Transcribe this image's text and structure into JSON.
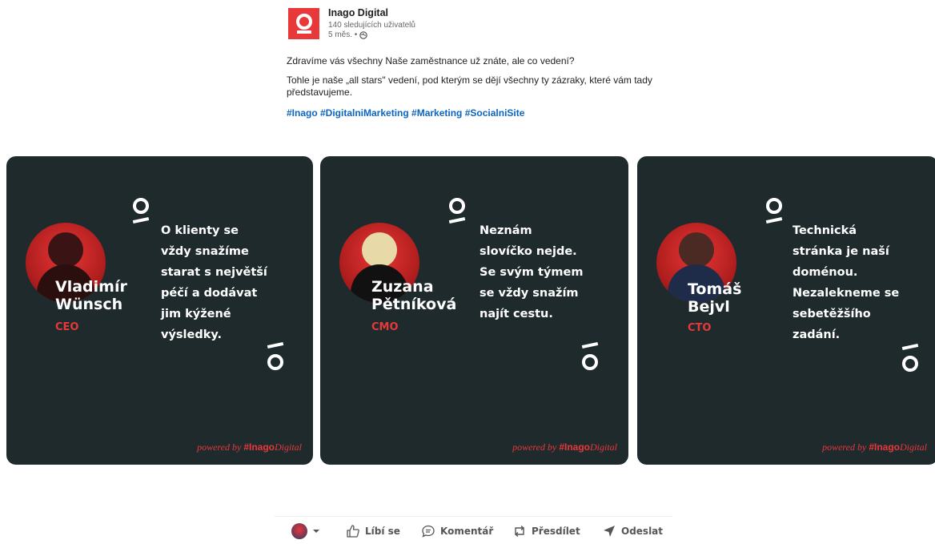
{
  "post": {
    "org_name": "Inago Digital",
    "followers": "140 sledujících uživatelů",
    "time": "5 měs. •",
    "line1": "Zdravíme vás všechny    Naše zaměstnance už znáte, ale co vedení?",
    "line2": "Tohle je naše „all stars\" vedení, pod kterým se dějí všechny ty zázraky, které vám tady představujeme.",
    "hashtags": "#Inago #DigitalniMarketing #Marketing #SocialniSite"
  },
  "cards": [
    {
      "name_line1": "Vladimír",
      "name_line2": "Wünsch",
      "role": "CEO",
      "quote": [
        "O klienty se",
        "vždy snažíme",
        "starat s největší",
        "péčí a dodávat",
        "jim kýžené",
        "výsledky."
      ]
    },
    {
      "name_line1": "Zuzana",
      "name_line2": "Pětníková",
      "role": "CMO",
      "quote": [
        "Neznám",
        "slovíčko nejde.",
        "Se svým týmem",
        "se vždy snažím",
        "najít cestu."
      ]
    },
    {
      "name_line1": "Tomáš",
      "name_line2": "Bejvl",
      "role": "CTO",
      "quote": [
        "Technická",
        "stránka je naší",
        "doménou.",
        "Nezalekneme se",
        "sebetěžšího",
        "zadání."
      ]
    }
  ],
  "powered": {
    "prefix": "powered by ",
    "hash_brand": "#Inago",
    "suffix": "Digital"
  },
  "actions": {
    "like": "Líbí se",
    "comment": "Komentář",
    "share": "Přesdílet",
    "send": "Odeslat"
  },
  "colors": {
    "brand_red": "#e8383a",
    "card_bg": "#1f2a2d",
    "hashtag_blue": "#0a66c2"
  },
  "icons": [
    "globe-icon",
    "like-icon",
    "comment-icon",
    "repost-icon",
    "send-icon",
    "chevron-down-icon"
  ]
}
